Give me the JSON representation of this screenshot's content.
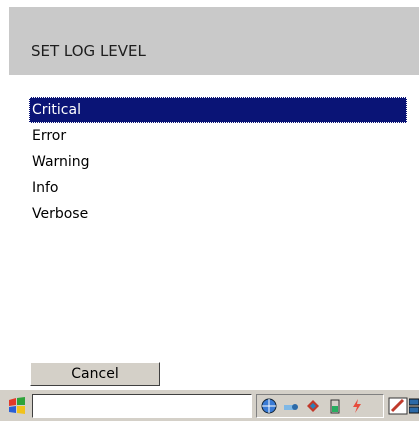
{
  "dialog": {
    "title": "SET LOG LEVEL"
  },
  "log_levels": [
    {
      "label": "Critical",
      "selected": true
    },
    {
      "label": "Error",
      "selected": false
    },
    {
      "label": "Warning",
      "selected": false
    },
    {
      "label": "Info",
      "selected": false
    },
    {
      "label": "Verbose",
      "selected": false
    }
  ],
  "buttons": {
    "cancel": "Cancel"
  },
  "taskbar": {
    "start_icon": "windows-flag-icon",
    "tray_icons": [
      "network-globe-icon",
      "connection-icon",
      "sync-icon",
      "battery-icon",
      "power-icon"
    ],
    "right_icons": [
      "pen-input-icon",
      "switch-windows-icon"
    ]
  },
  "colors": {
    "selection": "#0a1476",
    "title_bar": "#c9c9c9",
    "taskbar": "#d4d0c8"
  }
}
